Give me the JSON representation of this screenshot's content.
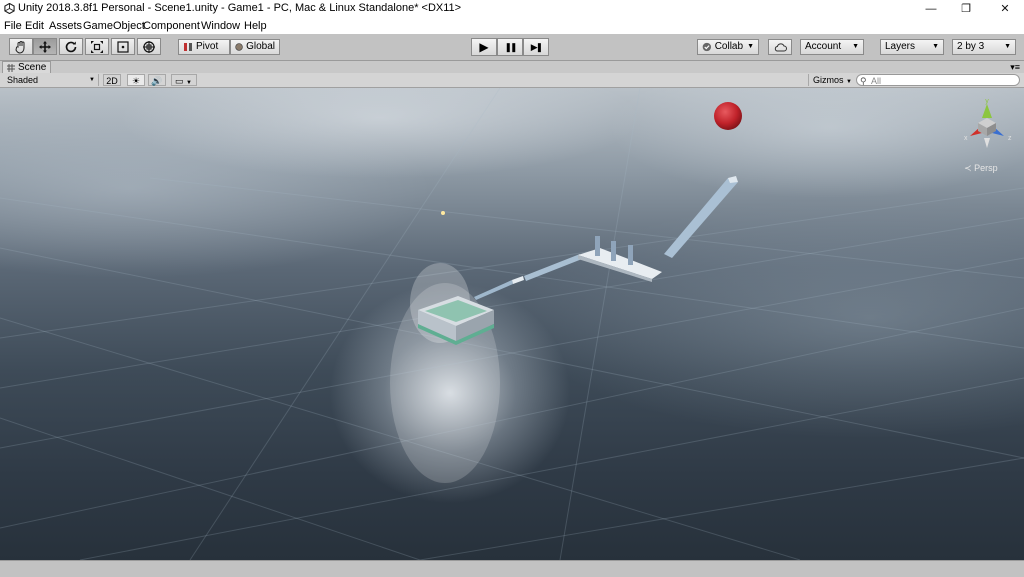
{
  "window": {
    "title": "Unity 2018.3.8f1 Personal - Scene1.unity - Game1 - PC, Mac & Linux Standalone* <DX11>",
    "minimize": "—",
    "maximize": "❐",
    "close": "✕"
  },
  "menu": [
    "File",
    "Edit",
    "Assets",
    "GameObject",
    "Component",
    "Window",
    "Help"
  ],
  "toolbar": {
    "tools": [
      "hand-tool",
      "move-tool",
      "rotate-tool",
      "scale-tool",
      "rect-tool",
      "transform-tool"
    ],
    "active_tool": "move-tool",
    "pivot": "Pivot",
    "global": "Global",
    "play": "▶",
    "pause": "❚❚",
    "step": "▶❚",
    "collab": "Collab",
    "account": "Account",
    "layers": "Layers",
    "layout": "2 by 3"
  },
  "scene_tab": {
    "label": "Scene"
  },
  "scene_toolbar": {
    "shading": "Shaded",
    "mode_2d": "2D",
    "gizmos": "Gizmos",
    "search_placeholder": "All"
  },
  "viewport": {
    "projection": "Persp",
    "gizmo_axes": [
      "x",
      "y",
      "z"
    ],
    "colors": {
      "ball": "#c0222a",
      "axis_x": "#d0302a",
      "axis_y": "#8cc63f",
      "axis_z": "#3a6fd0"
    }
  }
}
